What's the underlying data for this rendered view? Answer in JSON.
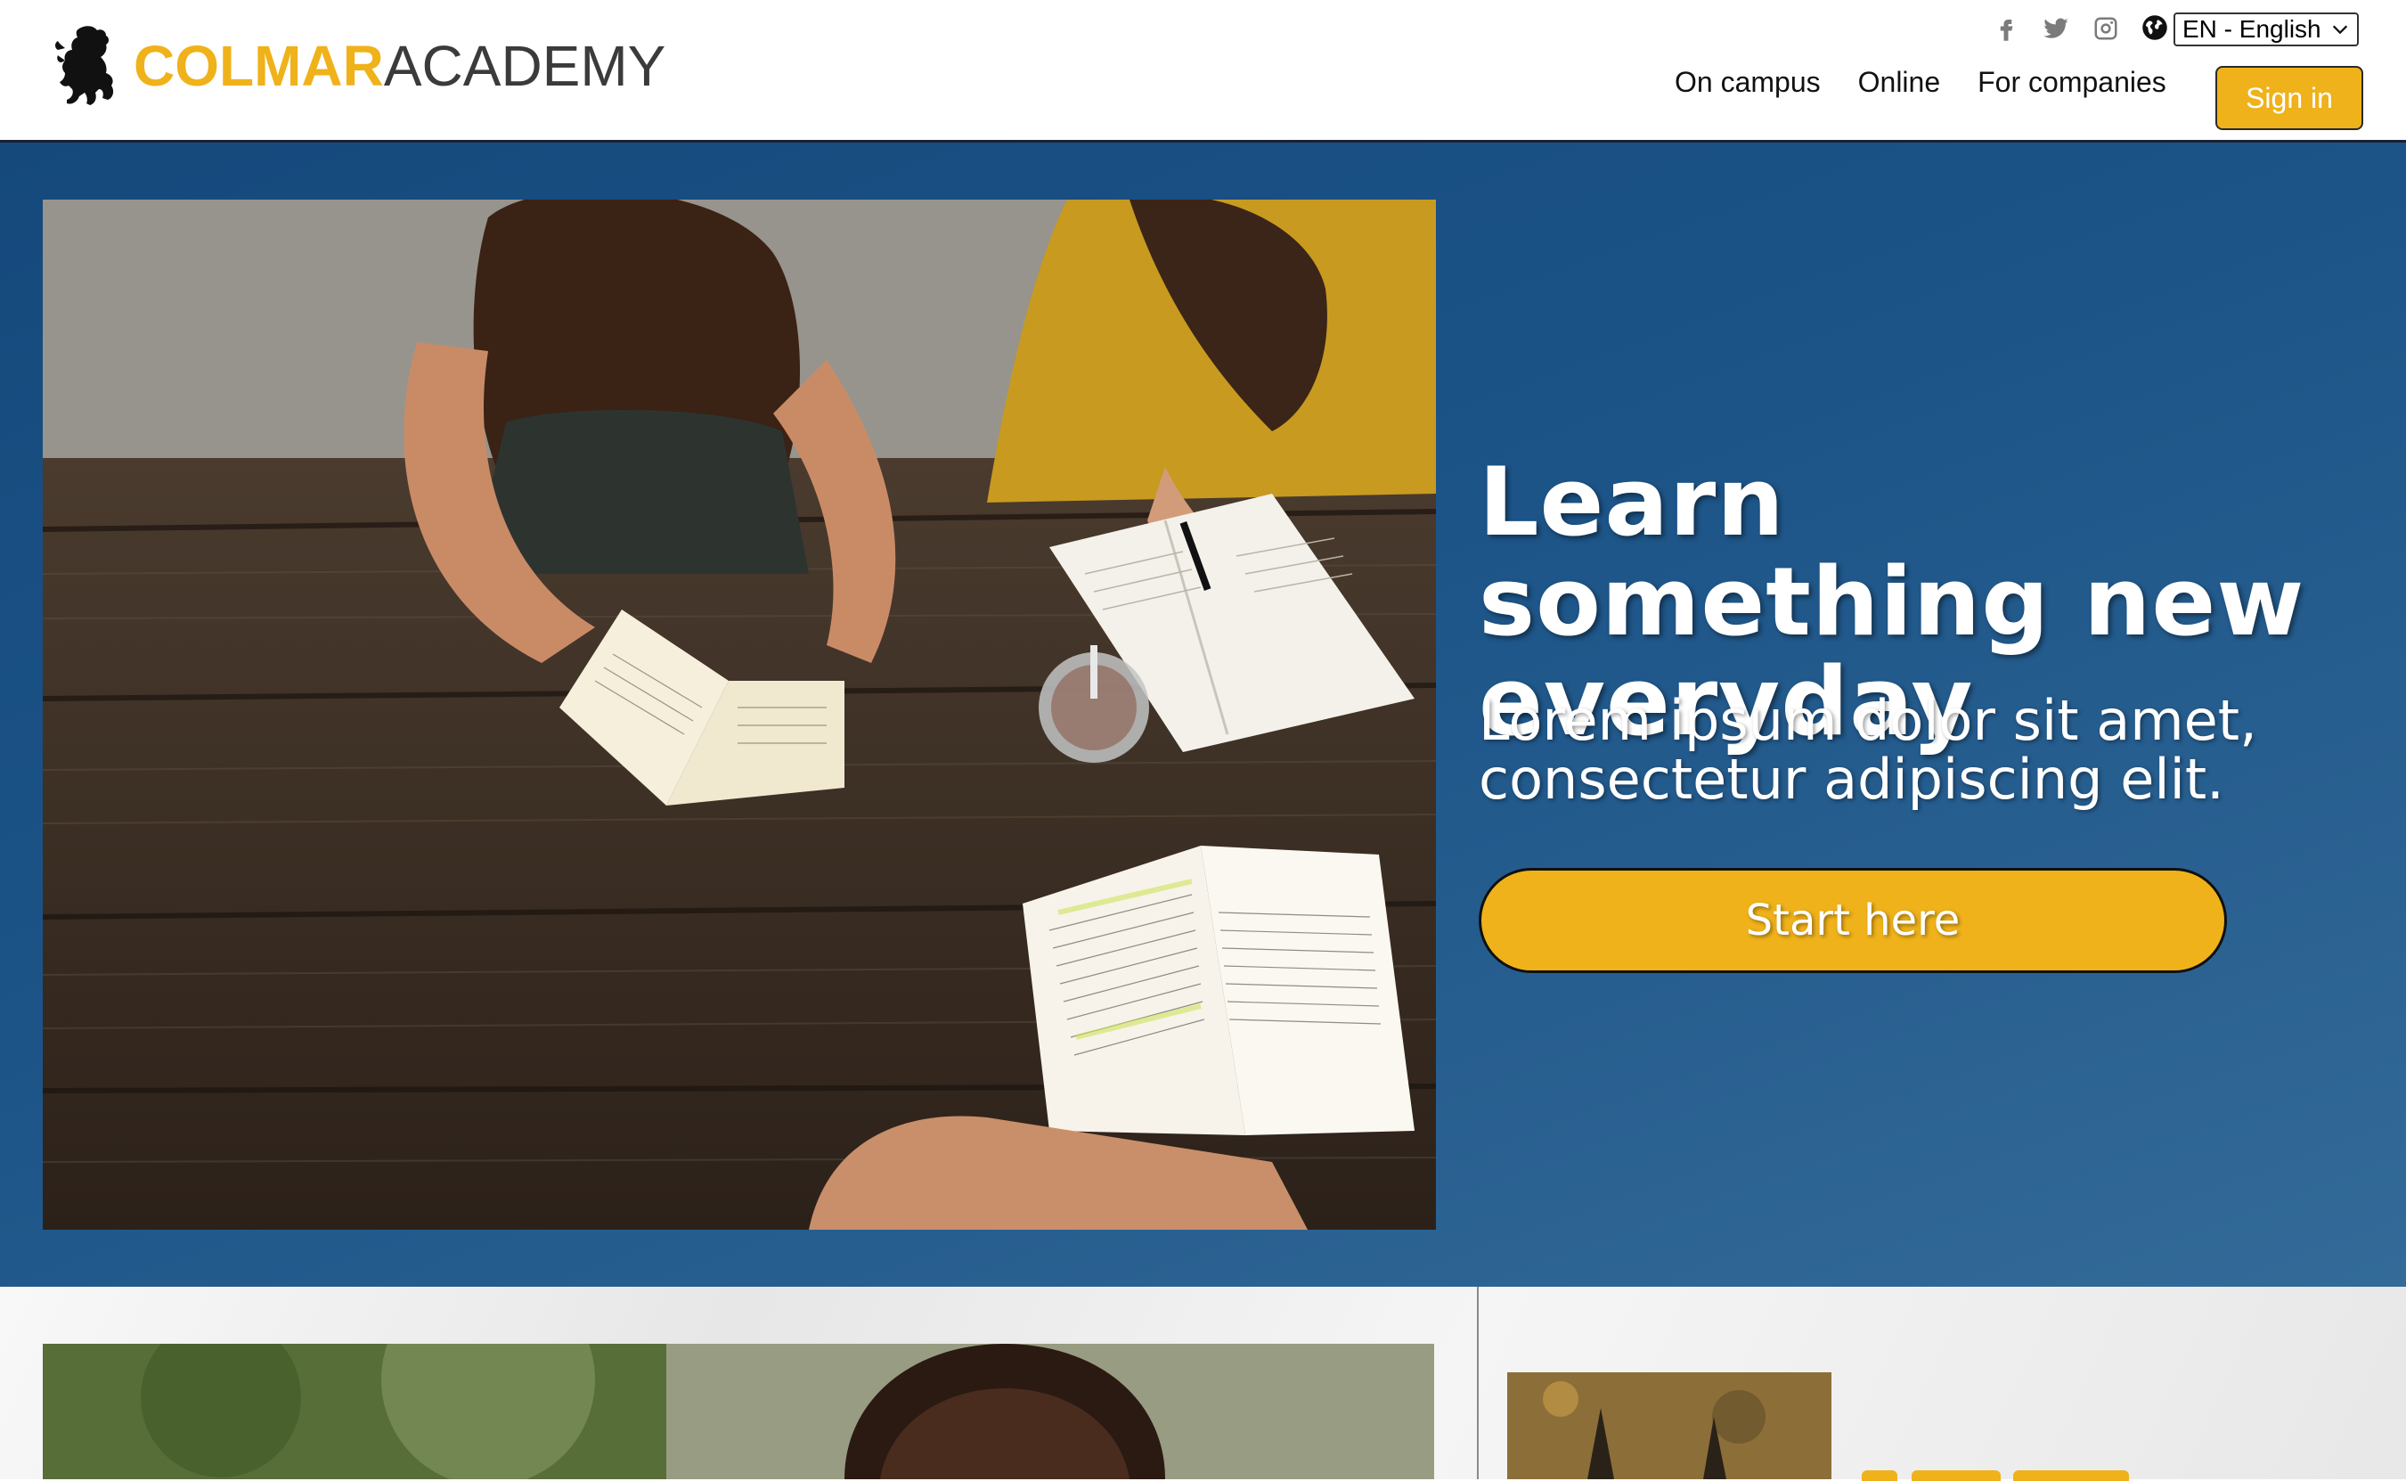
{
  "brand": {
    "name_part1": "COLMAR",
    "name_part2": "ACADEMY",
    "color_primary": "#f0b21a",
    "color_text": "#3b3b3b"
  },
  "header": {
    "social": [
      "facebook-icon",
      "twitter-icon",
      "instagram-icon"
    ],
    "language": {
      "icon": "globe-icon",
      "selected": "EN - English"
    },
    "nav": [
      {
        "label": "On campus"
      },
      {
        "label": "Online"
      },
      {
        "label": "For companies"
      }
    ],
    "signin_label": "Sign in"
  },
  "hero": {
    "title": "Learn something new everyday",
    "subtitle": "Lorem ipsum dolor sit amet, consectetur adipiscing elit.",
    "cta_label": "Start here",
    "background_color": "#1c5488"
  }
}
